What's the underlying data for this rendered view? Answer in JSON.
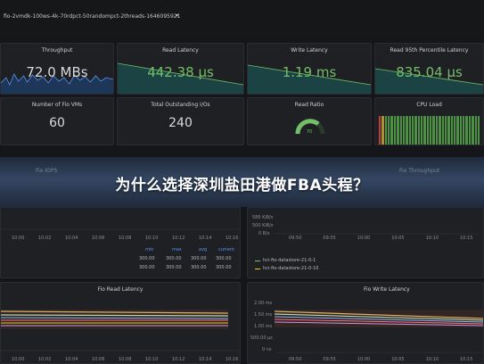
{
  "dashboard": {
    "title": "fio-2vmdk-100ws-4k-70rdpct-50randompct-2threads-1646095921",
    "caret": "▾"
  },
  "stats_row1": [
    {
      "title": "Throughput",
      "value": "72.0 MBs",
      "color": "white"
    },
    {
      "title": "Read Latency",
      "value": "442.38 μs",
      "color": "green"
    },
    {
      "title": "Write Latency",
      "value": "1.19 ms",
      "color": "green"
    },
    {
      "title": "Read 95th Percentile Latency",
      "value": "835.04 μs",
      "color": "green"
    }
  ],
  "stats_row2": [
    {
      "title": "Number of Fio VMs",
      "value": "60"
    },
    {
      "title": "Total Outstanding I/Os",
      "value": "240"
    },
    {
      "title": "Read Ratio",
      "value": "70"
    },
    {
      "title": "CPU Load",
      "value": ""
    }
  ],
  "banner": {
    "text": "为什么选择深圳盐田港做FBA头程？"
  },
  "iops_panel": {
    "title": "Fio IOPS",
    "xticks": [
      "10:00",
      "10:02",
      "10:04",
      "10:06",
      "10:08",
      "10:10",
      "10:12",
      "10:14",
      "10:16"
    ],
    "table_headers": [
      "min",
      "max",
      "avg",
      "current"
    ],
    "table_rows": [
      [
        "300.00",
        "300.00",
        "300.00",
        "300.00"
      ],
      [
        "300.00",
        "300.00",
        "300.00",
        "300.00"
      ]
    ]
  },
  "throughput_panel": {
    "title": "Fio Throughput",
    "yticks": [
      "586 KiB/s",
      "500 KiB/s",
      "0 B/s"
    ],
    "xticks": [
      "09:50",
      "09:55",
      "10:00",
      "10:05",
      "10:10",
      "10:15"
    ],
    "legend": [
      "hci-fio-datastore-21-0-1",
      "hci-fio-datastore-21-0-10"
    ]
  },
  "read_latency_panel": {
    "title": "Fio Read Latency",
    "xticks": [
      "10:00",
      "10:02",
      "10:04",
      "10:06",
      "10:08",
      "10:10",
      "10:12",
      "10:14",
      "10:16"
    ]
  },
  "write_latency_panel": {
    "title": "Fio Write Latency",
    "yticks": [
      "2.00 ms",
      "1.50 ms",
      "1.00 ms",
      "500.00 μs",
      "0 ns"
    ],
    "xticks": [
      "09:50",
      "09:55",
      "10:00",
      "10:05",
      "10:10",
      "10:15"
    ]
  },
  "colors": {
    "green": "#73bf69",
    "blue": "#5794f2",
    "panel": "#1f2024",
    "background": "#141619"
  }
}
